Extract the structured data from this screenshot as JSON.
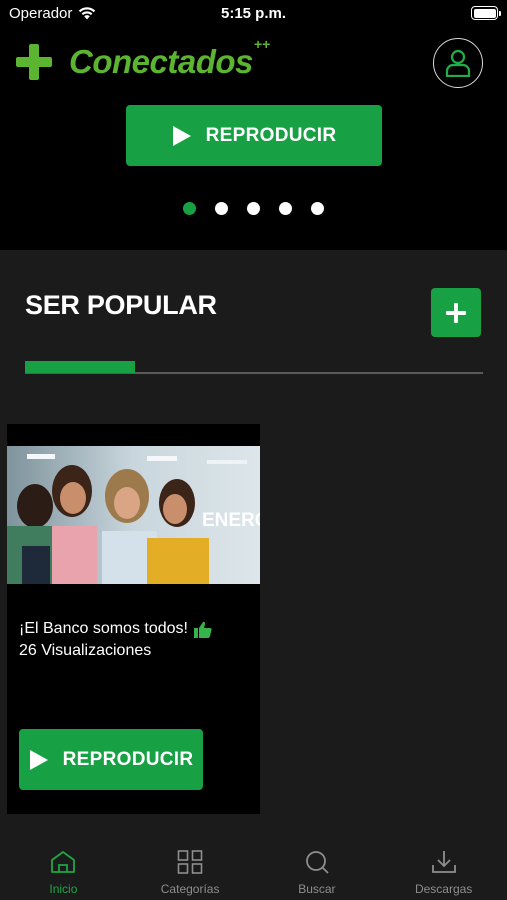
{
  "status_bar": {
    "carrier": "Operador",
    "time": "5:15 p.m."
  },
  "header": {
    "logo_text": "Conectados",
    "logo_sparks": "++",
    "hero_play_label": "REPRODUCIR",
    "carousel": {
      "count": 5,
      "active_index": 0
    }
  },
  "section": {
    "title": "SER POPULAR",
    "scroll_progress_percent": 24,
    "card": {
      "title": "¡El Banco somos todos!",
      "views": "26 Visualizaciones",
      "thumbnail_text": "ENERG",
      "play_label": "REPRODUCIR"
    }
  },
  "tab_bar": {
    "tabs": [
      {
        "label": "Inicio",
        "icon": "home-icon",
        "active": true
      },
      {
        "label": "Categorías",
        "icon": "grid-icon",
        "active": false
      },
      {
        "label": "Buscar",
        "icon": "search-icon",
        "active": false
      },
      {
        "label": "Descargas",
        "icon": "download-icon",
        "active": false
      }
    ]
  },
  "colors": {
    "brand_green": "#18a144",
    "logo_green": "#5cb531",
    "section_bg": "#1b1b1b",
    "inactive_tab": "#8e8e8e"
  }
}
